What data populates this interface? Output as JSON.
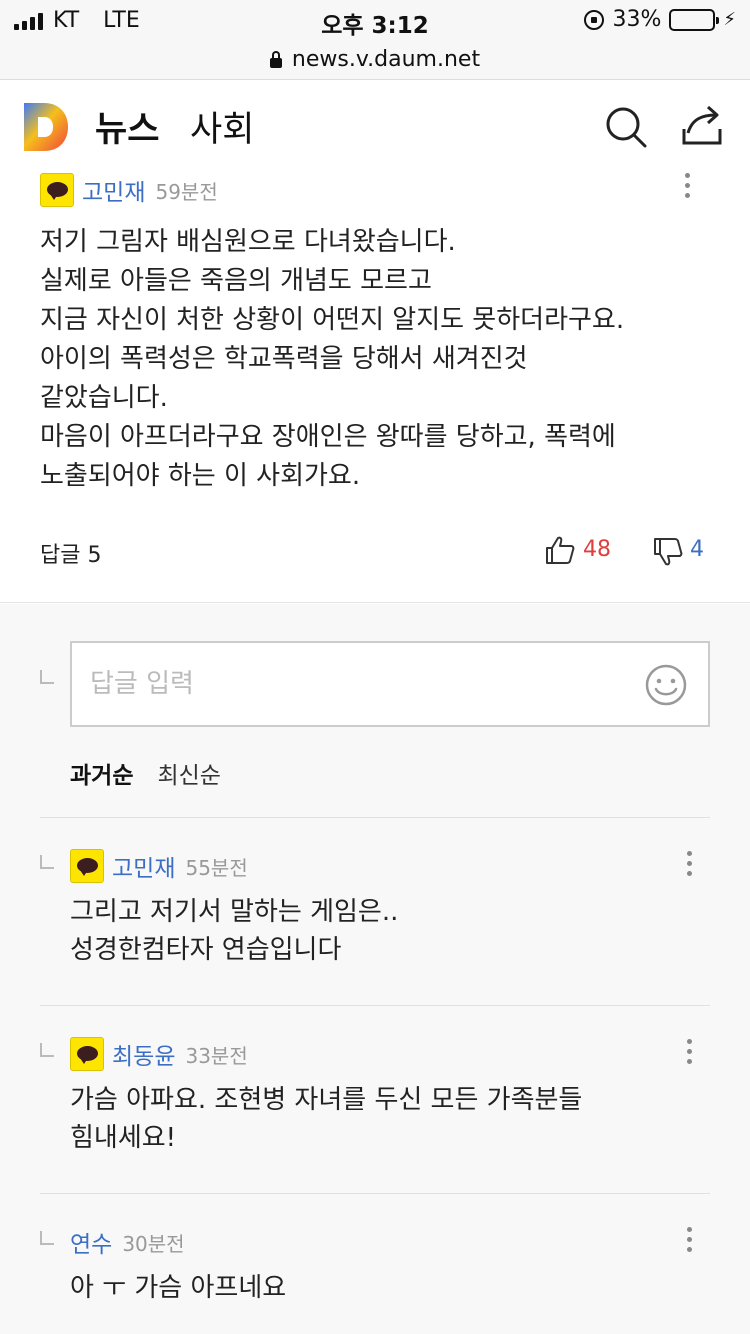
{
  "status_bar": {
    "carrier": "KT",
    "network": "LTE",
    "time": "오후 3:12",
    "battery_percent": "33%",
    "battery_level": 0.33,
    "battery_color": "#4cd964"
  },
  "url_bar": {
    "url": "news.v.daum.net",
    "icon": "lock-icon"
  },
  "header": {
    "brand": "뉴스",
    "section": "사회",
    "logo_icon": "daum-logo-icon",
    "actions": [
      "search-icon",
      "share-icon"
    ]
  },
  "main_comment": {
    "author": "고민재",
    "time": "59분전",
    "badge_icon": "kakao-icon",
    "text": "저기 그림자 배심원으로 다녀왔습니다.\n실제로 아들은 죽음의 개념도 모르고\n지금 자신이 처한 상황이 어떤지 알지도 못하더라구요.\n아이의 폭력성은 학교폭력을 당해서 새겨진것\n같았습니다.\n마음이 아프더라구요 장애인은 왕따를 당하고, 폭력에\n노출되어야 하는 이 사회가요.",
    "replies_label": "답글 5",
    "likes": "48",
    "dislikes": "4",
    "like_color": "#e03d3d",
    "dislike_color": "#3c6fc4"
  },
  "reply_input": {
    "placeholder": "답글 입력",
    "value": ""
  },
  "sort": {
    "active": "과거순",
    "other": "최신순"
  },
  "replies": [
    {
      "author": "고민재",
      "time": "55분전",
      "kakao": true,
      "text": "그리고 저기서 말하는 게임은..\n성경한컴타자 연습입니다"
    },
    {
      "author": "최동윤",
      "time": "33분전",
      "kakao": true,
      "text": "가슴 아파요. 조현병 자녀를 두신 모든 가족분들\n힘내세요!"
    },
    {
      "author": "연수",
      "time": "30분전",
      "kakao": false,
      "text": "아 ㅜ 가슴 아프네요"
    }
  ],
  "colors": {
    "author": "#3c6fc4",
    "kakao_yellow": "#fee500",
    "reply_bg": "#f8f8f8"
  }
}
